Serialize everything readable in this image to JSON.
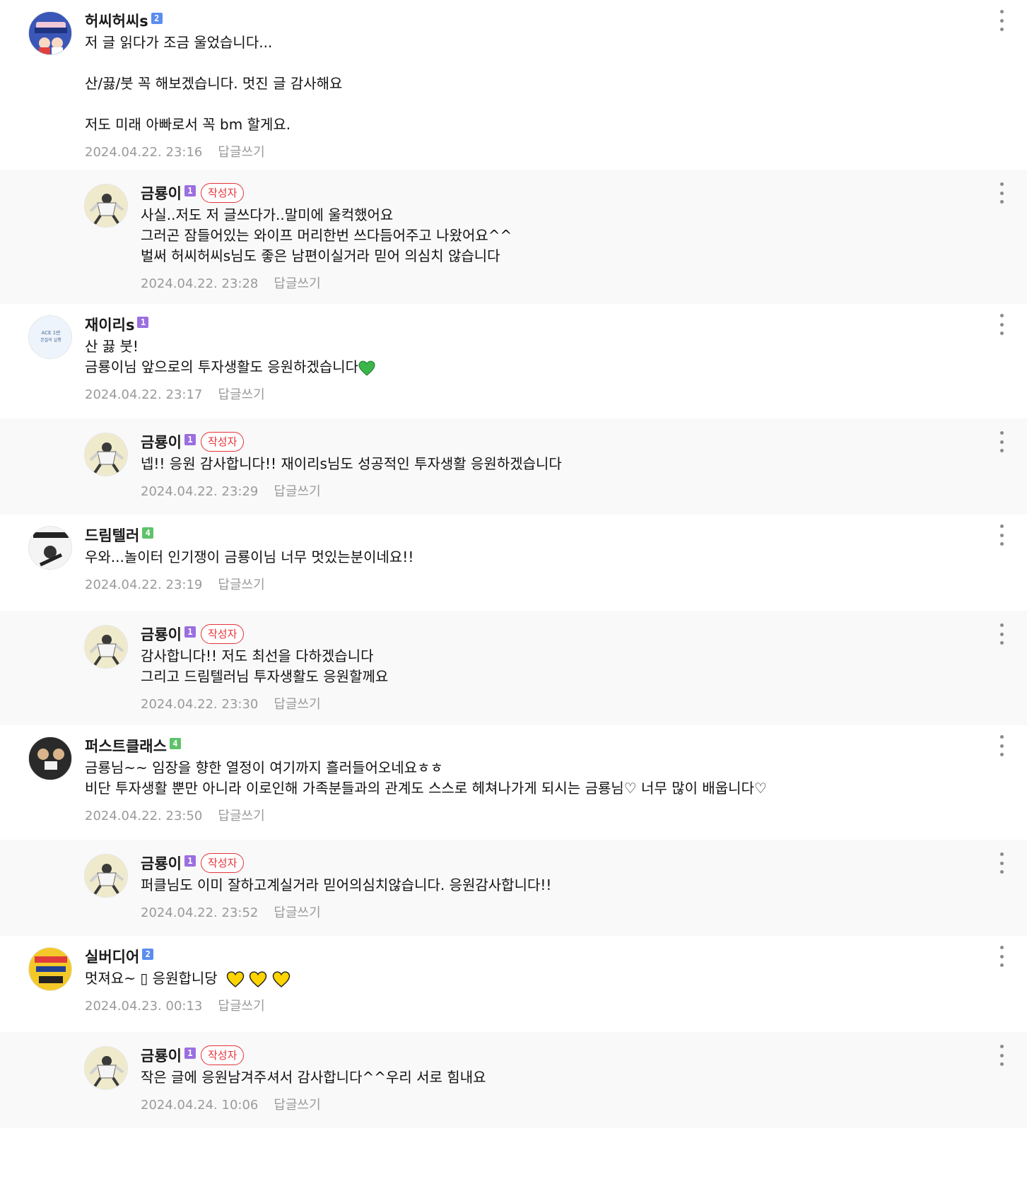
{
  "comments": [
    {
      "nick": "허씨허씨s",
      "level": "2",
      "level_color": "#5b8def",
      "lines": [
        "저 글 읽다가 조금 울었습니다..."
      ],
      "lines2": [
        "산/끓/붓 꼭 해보겠습니다. 멋진 글 감사해요"
      ],
      "lines3": [
        "저도 미래 아빠로서 꼭 bm 할게요."
      ],
      "date": "2024.04.22. 23:16",
      "reply_label": "답글쓰기",
      "avatar_text": "허씨허씨 with 길씨"
    },
    {
      "nick": "금룡이",
      "level": "1",
      "level_color": "#9b6fe0",
      "author_badge": "작성자",
      "lines": [
        "사실..저도 저 글쓰다가..말미에 울컥했어요",
        "그러곤 잠들어있는 와이프 머리한번 쓰다듬어주고 나왔어요^^",
        "벌써 허씨허씨s님도 좋은 남편이실거라 믿어 의심치 않습니다"
      ],
      "date": "2024.04.22. 23:28",
      "reply_label": "답글쓰기"
    },
    {
      "nick": "재이리s",
      "level": "1",
      "level_color": "#9b6fe0",
      "lines": [
        "산 끓 붓!",
        "금룡이님 앞으로의 투자생활도 응원하겠습니다"
      ],
      "date": "2024.04.22. 23:17",
      "reply_label": "답글쓰기",
      "avatar_text": "ACE 1반 본질의 실행"
    },
    {
      "nick": "금룡이",
      "level": "1",
      "level_color": "#9b6fe0",
      "author_badge": "작성자",
      "lines": [
        "넵!! 응원 감사합니다!! 재이리s님도 성공적인 투자생활 응원하겠습니다"
      ],
      "date": "2024.04.22. 23:29",
      "reply_label": "답글쓰기"
    },
    {
      "nick": "드림텔러",
      "level": "4",
      "level_color": "#5ec26a",
      "lines": [
        "우와...놀이터 인기쟁이 금룡이님 너무 멋있는분이네요!!"
      ],
      "date": "2024.04.22. 23:19",
      "reply_label": "답글쓰기"
    },
    {
      "nick": "금룡이",
      "level": "1",
      "level_color": "#9b6fe0",
      "author_badge": "작성자",
      "lines": [
        "감사합니다!! 저도 최선을 다하겠습니다",
        "그리고 드림텔러님 투자생활도 응원할께요"
      ],
      "date": "2024.04.22. 23:30",
      "reply_label": "답글쓰기"
    },
    {
      "nick": "퍼스트클래스",
      "level": "4",
      "level_color": "#5ec26a",
      "lines": [
        "금룡님~~ 임장을 향한 열정이 여기까지 흘러들어오네요ㅎㅎ",
        "비단 투자생활 뿐만 아니라 이로인해 가족분들과의 관계도 스스로 헤쳐나가게 되시는 금룡님♡ 너무 많이 배웁니다♡"
      ],
      "date": "2024.04.22. 23:50",
      "reply_label": "답글쓰기"
    },
    {
      "nick": "금룡이",
      "level": "1",
      "level_color": "#9b6fe0",
      "author_badge": "작성자",
      "lines": [
        "퍼클님도 이미 잘하고계실거라 믿어의심치않습니다. 응원감사합니다!!"
      ],
      "date": "2024.04.22. 23:52",
      "reply_label": "답글쓰기"
    },
    {
      "nick": "실버디어",
      "level": "2",
      "level_color": "#5b8def",
      "lines": [
        "멋져요~ ▯ 응원합니당"
      ],
      "date": "2024.04.23. 00:13",
      "reply_label": "답글쓰기"
    },
    {
      "nick": "금룡이",
      "level": "1",
      "level_color": "#9b6fe0",
      "author_badge": "작성자",
      "lines": [
        "작은 글에 응원남겨주셔서 감사합니다^^우리 서로 힘내요"
      ],
      "date": "2024.04.24. 10:06",
      "reply_label": "답글쓰기"
    }
  ]
}
